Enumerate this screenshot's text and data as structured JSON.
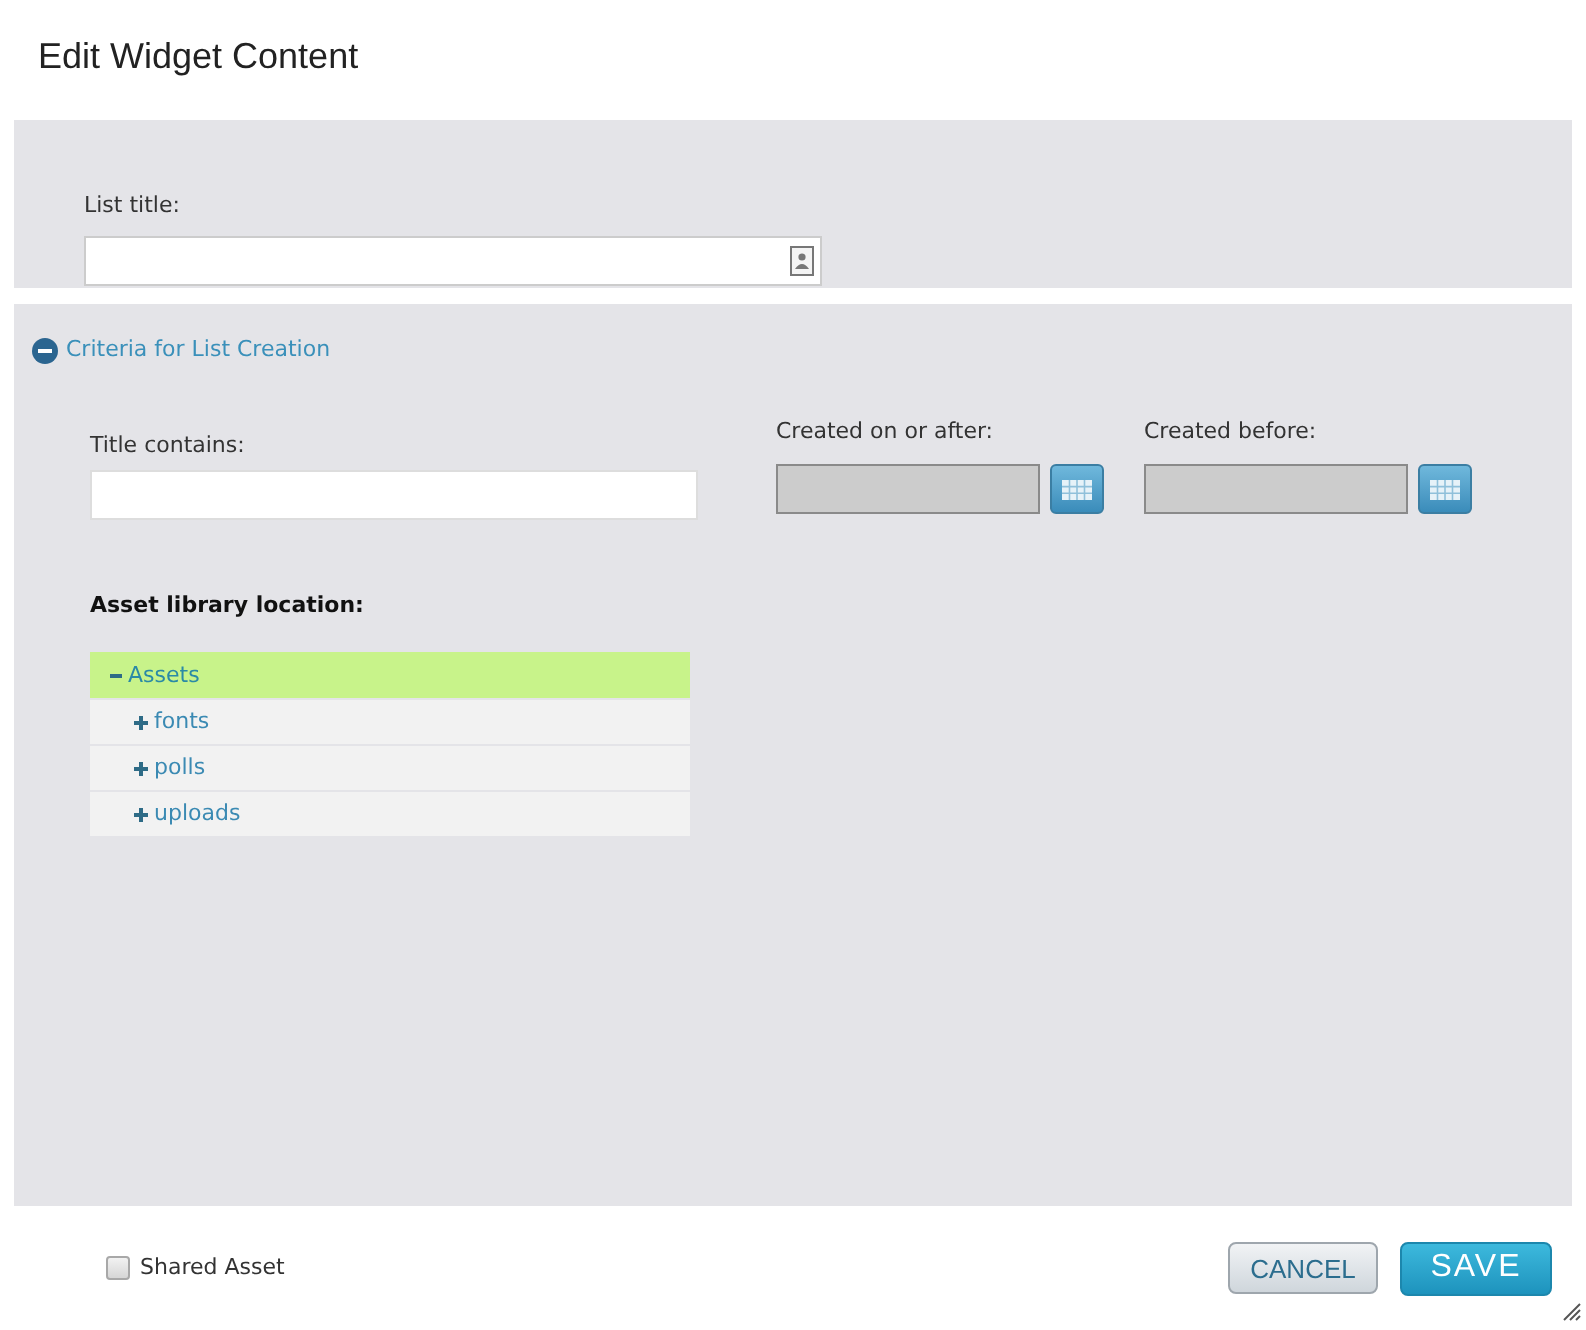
{
  "dialog": {
    "title": "Edit Widget Content"
  },
  "list_title": {
    "label": "List title:"
  },
  "criteria": {
    "label": "Criteria for List Creation",
    "expanded": true,
    "title_contains": {
      "label": "Title contains:"
    },
    "date_fields": [
      {
        "label": "Created on or after:",
        "disabled": true
      },
      {
        "label": "Created before:",
        "disabled": true
      }
    ],
    "asset_location": {
      "label": "Asset library location:",
      "tree": [
        {
          "label": "Assets",
          "expanded": true,
          "selected": true,
          "children": [
            {
              "label": "fonts",
              "expanded": false,
              "selected": false
            },
            {
              "label": "polls",
              "expanded": false,
              "selected": false
            },
            {
              "label": "uploads",
              "expanded": false,
              "selected": false
            }
          ]
        }
      ]
    }
  },
  "footer": {
    "shared_asset": {
      "label": "Shared Asset",
      "checked": false
    },
    "buttons": [
      {
        "label": "CANCEL",
        "kind": "secondary"
      },
      {
        "label": "SAVE",
        "kind": "primary"
      }
    ]
  }
}
